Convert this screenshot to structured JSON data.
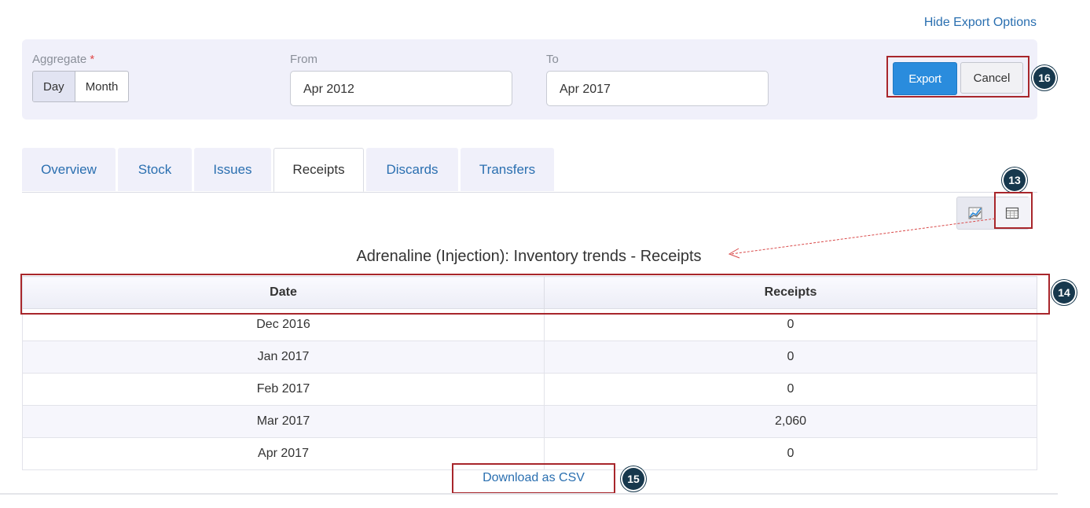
{
  "header": {
    "hide_export_label": "Hide Export Options"
  },
  "export": {
    "aggregate_label": "Aggregate",
    "required_mark": "*",
    "aggregate_options": [
      "Day",
      "Month"
    ],
    "from_label": "From",
    "from_value": "Apr 2012",
    "to_label": "To",
    "to_value": "Apr 2017",
    "export_label": "Export",
    "cancel_label": "Cancel"
  },
  "tabs": [
    {
      "label": "Overview"
    },
    {
      "label": "Stock"
    },
    {
      "label": "Issues"
    },
    {
      "label": "Receipts"
    },
    {
      "label": "Discards"
    },
    {
      "label": "Transfers"
    }
  ],
  "active_tab": "Receipts",
  "view_toggle": {
    "chart_icon": "chart-icon",
    "table_icon": "table-icon"
  },
  "chart_title": "Adrenaline (Injection): Inventory trends - Receipts",
  "table": {
    "columns": [
      "Date",
      "Receipts"
    ],
    "rows": [
      [
        "Dec 2016",
        "0"
      ],
      [
        "Jan 2017",
        "0"
      ],
      [
        "Feb 2017",
        "0"
      ],
      [
        "Mar 2017",
        "2,060"
      ],
      [
        "Apr 2017",
        "0"
      ]
    ]
  },
  "download_label": "Download as CSV",
  "callouts": {
    "export_buttons": "16",
    "view_toggle": "13",
    "table_header": "14",
    "download": "15"
  },
  "colors": {
    "accent": "#2a8cdd",
    "link": "#2a6fb0",
    "highlight": "#a8262b",
    "badge": "#17384d"
  }
}
